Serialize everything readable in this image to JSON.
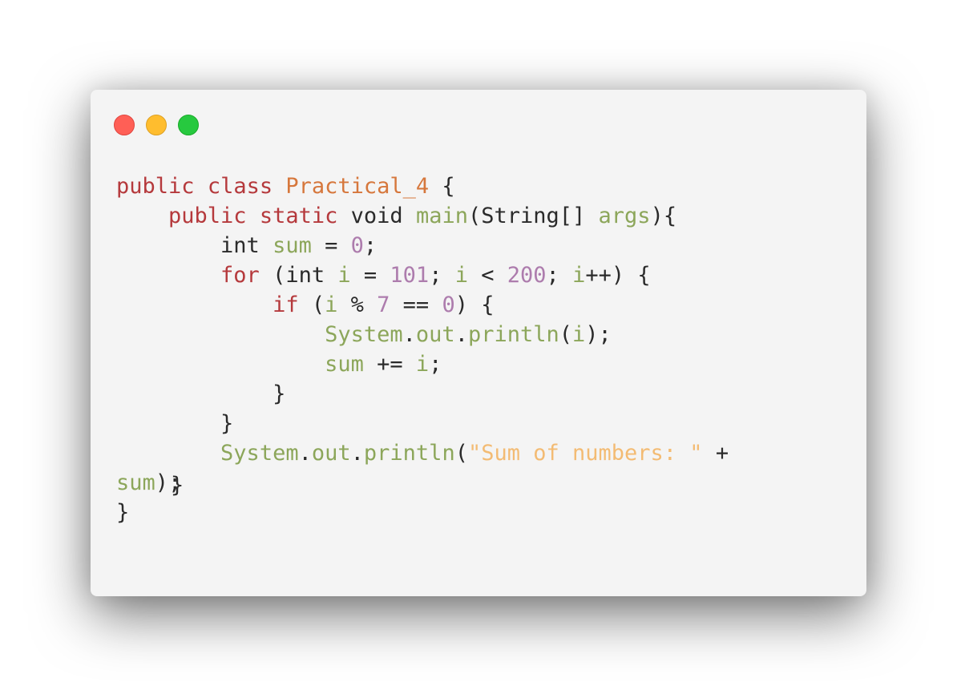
{
  "window": {
    "controls": {
      "close_color": "#ff5f56",
      "minimize_color": "#ffbd2e",
      "maximize_color": "#27c93f"
    }
  },
  "colors": {
    "keyword": "#b5393c",
    "class_name": "#d6773c",
    "identifier": "#8ca65a",
    "number": "#ad7cad",
    "string": "#f3bb73",
    "plain": "#2a2a2a",
    "background": "#f4f4f4"
  },
  "code": {
    "lines": [
      [
        {
          "t": "public",
          "c": "kw"
        },
        {
          "t": " ",
          "c": "pl"
        },
        {
          "t": "class",
          "c": "kw"
        },
        {
          "t": " ",
          "c": "pl"
        },
        {
          "t": "Practical_4",
          "c": "cls"
        },
        {
          "t": " {",
          "c": "pl"
        }
      ],
      [
        {
          "t": "    ",
          "c": "pl"
        },
        {
          "t": "public",
          "c": "kw"
        },
        {
          "t": " ",
          "c": "pl"
        },
        {
          "t": "static",
          "c": "kw"
        },
        {
          "t": " void ",
          "c": "pl"
        },
        {
          "t": "main",
          "c": "fn"
        },
        {
          "t": "(String[] ",
          "c": "pl"
        },
        {
          "t": "args",
          "c": "fn"
        },
        {
          "t": "){",
          "c": "pl"
        }
      ],
      [
        {
          "t": "        int ",
          "c": "pl"
        },
        {
          "t": "sum",
          "c": "fn"
        },
        {
          "t": " = ",
          "c": "pl"
        },
        {
          "t": "0",
          "c": "num"
        },
        {
          "t": ";",
          "c": "pl"
        }
      ],
      [
        {
          "t": "        ",
          "c": "pl"
        },
        {
          "t": "for",
          "c": "kw"
        },
        {
          "t": " (int ",
          "c": "pl"
        },
        {
          "t": "i",
          "c": "fn"
        },
        {
          "t": " = ",
          "c": "pl"
        },
        {
          "t": "101",
          "c": "num"
        },
        {
          "t": "; ",
          "c": "pl"
        },
        {
          "t": "i",
          "c": "fn"
        },
        {
          "t": " < ",
          "c": "pl"
        },
        {
          "t": "200",
          "c": "num"
        },
        {
          "t": "; ",
          "c": "pl"
        },
        {
          "t": "i",
          "c": "fn"
        },
        {
          "t": "++) {",
          "c": "pl"
        }
      ],
      [
        {
          "t": "            ",
          "c": "pl"
        },
        {
          "t": "if",
          "c": "kw"
        },
        {
          "t": " (",
          "c": "pl"
        },
        {
          "t": "i",
          "c": "fn"
        },
        {
          "t": " % ",
          "c": "pl"
        },
        {
          "t": "7",
          "c": "num"
        },
        {
          "t": " == ",
          "c": "pl"
        },
        {
          "t": "0",
          "c": "num"
        },
        {
          "t": ") {",
          "c": "pl"
        }
      ],
      [
        {
          "t": "                ",
          "c": "pl"
        },
        {
          "t": "System",
          "c": "fn"
        },
        {
          "t": ".",
          "c": "pl"
        },
        {
          "t": "out",
          "c": "fn"
        },
        {
          "t": ".",
          "c": "pl"
        },
        {
          "t": "println",
          "c": "fn"
        },
        {
          "t": "(",
          "c": "pl"
        },
        {
          "t": "i",
          "c": "fn"
        },
        {
          "t": ");",
          "c": "pl"
        }
      ],
      [
        {
          "t": "                ",
          "c": "pl"
        },
        {
          "t": "sum",
          "c": "fn"
        },
        {
          "t": " += ",
          "c": "pl"
        },
        {
          "t": "i",
          "c": "fn"
        },
        {
          "t": ";",
          "c": "pl"
        }
      ],
      [
        {
          "t": "            }",
          "c": "pl"
        }
      ],
      [
        {
          "t": "        }",
          "c": "pl"
        }
      ],
      [
        {
          "t": "        ",
          "c": "pl"
        },
        {
          "t": "System",
          "c": "fn"
        },
        {
          "t": ".",
          "c": "pl"
        },
        {
          "t": "out",
          "c": "fn"
        },
        {
          "t": ".",
          "c": "pl"
        },
        {
          "t": "println",
          "c": "fn"
        },
        {
          "t": "(",
          "c": "pl"
        },
        {
          "t": "\"Sum of numbers: \"",
          "c": "str"
        },
        {
          "t": " +",
          "c": "pl"
        }
      ],
      [
        {
          "t": "sum",
          "c": "fn"
        },
        {
          "t": ")",
          "c": "pl"
        },
        {
          "t": ";",
          "c": "pl",
          "overlap": "}"
        }
      ],
      [
        {
          "t": "}",
          "c": "pl"
        }
      ]
    ]
  }
}
